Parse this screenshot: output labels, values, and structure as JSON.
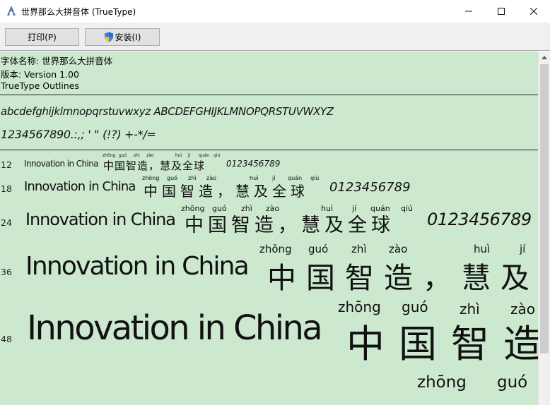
{
  "window": {
    "title": "世界那么大拼音体 (TrueType)",
    "controls": {
      "minimize": "—",
      "maximize": "☐",
      "close": "✕"
    }
  },
  "toolbar": {
    "print_label": "打印(P)",
    "install_label": "安装(I)"
  },
  "info": {
    "font_name": "字体名称: 世界那么大拼音体",
    "version": "版本: Version 1.00",
    "outline": "TrueType Outlines"
  },
  "glyphs": {
    "line1": "abcdefghijklmnopqrstuvwxyz ABCDEFGHIJKLMNOPQRSTUVWXYZ",
    "line2": "1234567890.:,; ' \" (!?) +-*/="
  },
  "samples": [
    {
      "size": "12",
      "latin": "Innovation in China",
      "hanzi": "中国智造，慧及全球",
      "digits": "0123456789",
      "pinyin": [
        "zhōng",
        "guó",
        "zhì",
        "zào",
        "",
        "huì",
        "jí",
        "quán",
        "qiú"
      ]
    },
    {
      "size": "18",
      "latin": "Innovation in China",
      "hanzi": "中国智造，慧及全球",
      "digits": "0123456789",
      "pinyin": [
        "zhōng",
        "guó",
        "zhì",
        "zào",
        "",
        "huì",
        "jí",
        "quán",
        "qiú"
      ]
    },
    {
      "size": "24",
      "latin": "Innovation in China",
      "hanzi": "中国智造，慧及全球",
      "digits": "0123456789",
      "pinyin": [
        "zhōng",
        "guó",
        "zhì",
        "zào",
        "",
        "huì",
        "jí",
        "quán",
        "qiú"
      ]
    },
    {
      "size": "36",
      "latin": "Innovation in China",
      "hanzi": "中国智造，慧及",
      "digits": "",
      "pinyin": [
        "zhōng",
        "guó",
        "zhì",
        "zào",
        "",
        "huì",
        "jí"
      ]
    },
    {
      "size": "48",
      "latin": "Innovation in China",
      "hanzi": "中国智造",
      "digits": "",
      "pinyin": [
        "zhōng",
        "guó",
        "zhì",
        "zào"
      ]
    }
  ],
  "partial_row": {
    "pinyin": [
      "zhōng",
      "guó"
    ]
  }
}
